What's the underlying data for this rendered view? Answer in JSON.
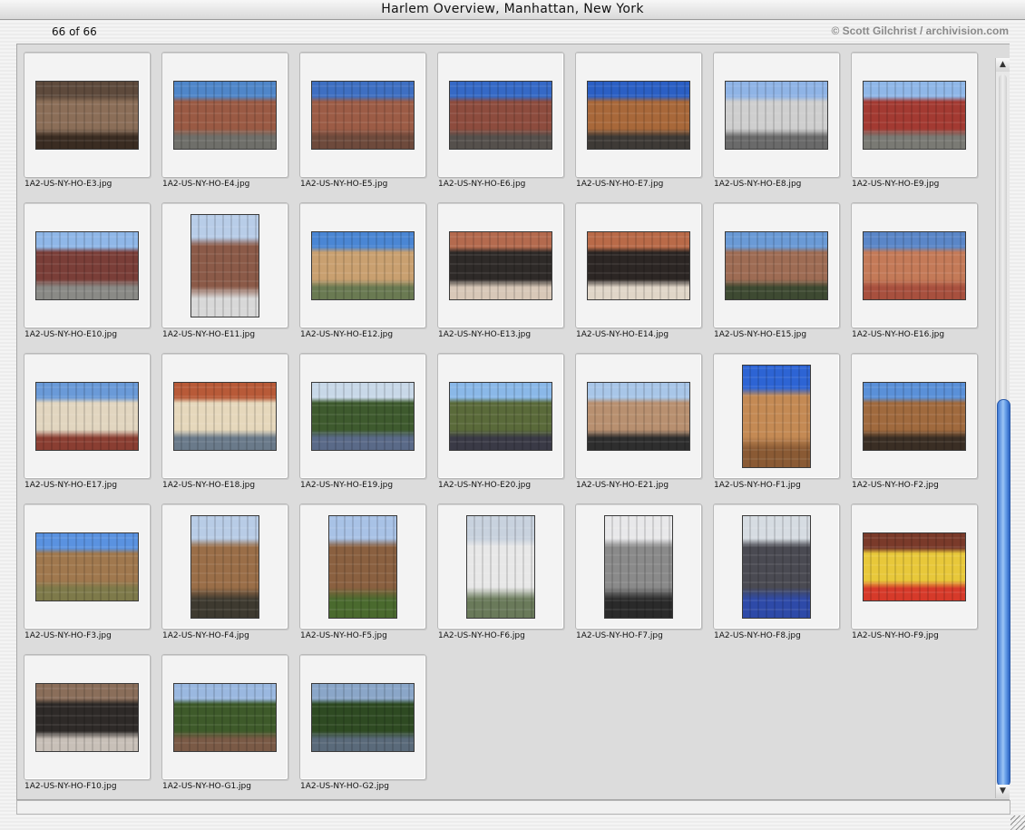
{
  "window": {
    "title": "Harlem Overview, Manhattan, New York"
  },
  "header": {
    "count": "66 of 66",
    "credit": "© Scott Gilchrist / archivision.com"
  },
  "items": [
    {
      "name": "1A2-US-NY-HO-E3.jpg",
      "orient": "land",
      "colors": [
        "#5e4a3c",
        "#8b6e58",
        "#3a2c22"
      ]
    },
    {
      "name": "1A2-US-NY-HO-E4.jpg",
      "orient": "land",
      "colors": [
        "#4f86c9",
        "#9a5a44",
        "#6f6f6a"
      ]
    },
    {
      "name": "1A2-US-NY-HO-E5.jpg",
      "orient": "land",
      "colors": [
        "#3e6fc2",
        "#9c5c46",
        "#6e4a3c"
      ]
    },
    {
      "name": "1A2-US-NY-HO-E6.jpg",
      "orient": "land",
      "colors": [
        "#3569c6",
        "#8d4c3e",
        "#55504c"
      ]
    },
    {
      "name": "1A2-US-NY-HO-E7.jpg",
      "orient": "land",
      "colors": [
        "#2b5fc4",
        "#a8683a",
        "#3e3a36"
      ]
    },
    {
      "name": "1A2-US-NY-HO-E8.jpg",
      "orient": "land",
      "colors": [
        "#8fb4e6",
        "#cfcfcf",
        "#6a6a6a"
      ]
    },
    {
      "name": "1A2-US-NY-HO-E9.jpg",
      "orient": "land",
      "colors": [
        "#8fb7e8",
        "#a33a32",
        "#7a7a74"
      ]
    },
    {
      "name": "1A2-US-NY-HO-E10.jpg",
      "orient": "land",
      "colors": [
        "#8fb7e8",
        "#7a3e38",
        "#8a8a86"
      ]
    },
    {
      "name": "1A2-US-NY-HO-E11.jpg",
      "orient": "port",
      "colors": [
        "#b8cde8",
        "#8b5a48",
        "#d8d8d8"
      ]
    },
    {
      "name": "1A2-US-NY-HO-E12.jpg",
      "orient": "land",
      "colors": [
        "#4a86d4",
        "#c9a070",
        "#6a7a52"
      ]
    },
    {
      "name": "1A2-US-NY-HO-E13.jpg",
      "orient": "land",
      "colors": [
        "#b46a4e",
        "#2e2a28",
        "#d8c8b8"
      ]
    },
    {
      "name": "1A2-US-NY-HO-E14.jpg",
      "orient": "land",
      "colors": [
        "#b96a48",
        "#2c2624",
        "#e0d6c8"
      ]
    },
    {
      "name": "1A2-US-NY-HO-E15.jpg",
      "orient": "land",
      "colors": [
        "#6a9ad6",
        "#9e6c54",
        "#3e4a32"
      ]
    },
    {
      "name": "1A2-US-NY-HO-E16.jpg",
      "orient": "land",
      "colors": [
        "#5a86c8",
        "#c47a58",
        "#a8503e"
      ]
    },
    {
      "name": "1A2-US-NY-HO-E17.jpg",
      "orient": "land",
      "colors": [
        "#6a9ad8",
        "#e2d6c0",
        "#8a3e32"
      ]
    },
    {
      "name": "1A2-US-NY-HO-E18.jpg",
      "orient": "land",
      "colors": [
        "#b85a38",
        "#e6d8bc",
        "#6a7a8a"
      ]
    },
    {
      "name": "1A2-US-NY-HO-E19.jpg",
      "orient": "land",
      "colors": [
        "#c8d8e8",
        "#3e5a2e",
        "#5a6a88"
      ]
    },
    {
      "name": "1A2-US-NY-HO-E20.jpg",
      "orient": "land",
      "colors": [
        "#8ab8e8",
        "#5a6a3a",
        "#3a3a46"
      ]
    },
    {
      "name": "1A2-US-NY-HO-E21.jpg",
      "orient": "land",
      "colors": [
        "#a8c6e8",
        "#b89070",
        "#2e2e2e"
      ]
    },
    {
      "name": "1A2-US-NY-HO-F1.jpg",
      "orient": "port",
      "colors": [
        "#2d64d4",
        "#c48a54",
        "#8a5a34"
      ]
    },
    {
      "name": "1A2-US-NY-HO-F2.jpg",
      "orient": "land",
      "colors": [
        "#5a90d8",
        "#a06a3e",
        "#3a2e24"
      ]
    },
    {
      "name": "1A2-US-NY-HO-F3.jpg",
      "orient": "land",
      "colors": [
        "#5a92e0",
        "#a0784e",
        "#7e7a4a"
      ]
    },
    {
      "name": "1A2-US-NY-HO-F4.jpg",
      "orient": "port",
      "colors": [
        "#b8cce6",
        "#9a6e48",
        "#3e3a30"
      ]
    },
    {
      "name": "1A2-US-NY-HO-F5.jpg",
      "orient": "port",
      "colors": [
        "#a8c2e6",
        "#8a6040",
        "#4a6a2e"
      ]
    },
    {
      "name": "1A2-US-NY-HO-F6.jpg",
      "orient": "port",
      "colors": [
        "#c8d2de",
        "#e8e8e8",
        "#6a7a5a"
      ]
    },
    {
      "name": "1A2-US-NY-HO-F7.jpg",
      "orient": "port",
      "colors": [
        "#e8e8ea",
        "#8a8a8a",
        "#2a2a2a"
      ]
    },
    {
      "name": "1A2-US-NY-HO-F8.jpg",
      "orient": "port",
      "colors": [
        "#d6dce2",
        "#4a4a52",
        "#2e4aa8"
      ]
    },
    {
      "name": "1A2-US-NY-HO-F9.jpg",
      "orient": "land",
      "colors": [
        "#7a3a2a",
        "#e8c83a",
        "#d63a2a"
      ]
    },
    {
      "name": "1A2-US-NY-HO-F10.jpg",
      "orient": "land",
      "colors": [
        "#8a6e5a",
        "#2e2a28",
        "#c8c0b8"
      ]
    },
    {
      "name": "1A2-US-NY-HO-G1.jpg",
      "orient": "land",
      "colors": [
        "#9ab8e0",
        "#3e5a2a",
        "#7a5a46"
      ]
    },
    {
      "name": "1A2-US-NY-HO-G2.jpg",
      "orient": "land",
      "colors": [
        "#8aa6c8",
        "#2e4a22",
        "#5a6a7a"
      ]
    }
  ]
}
